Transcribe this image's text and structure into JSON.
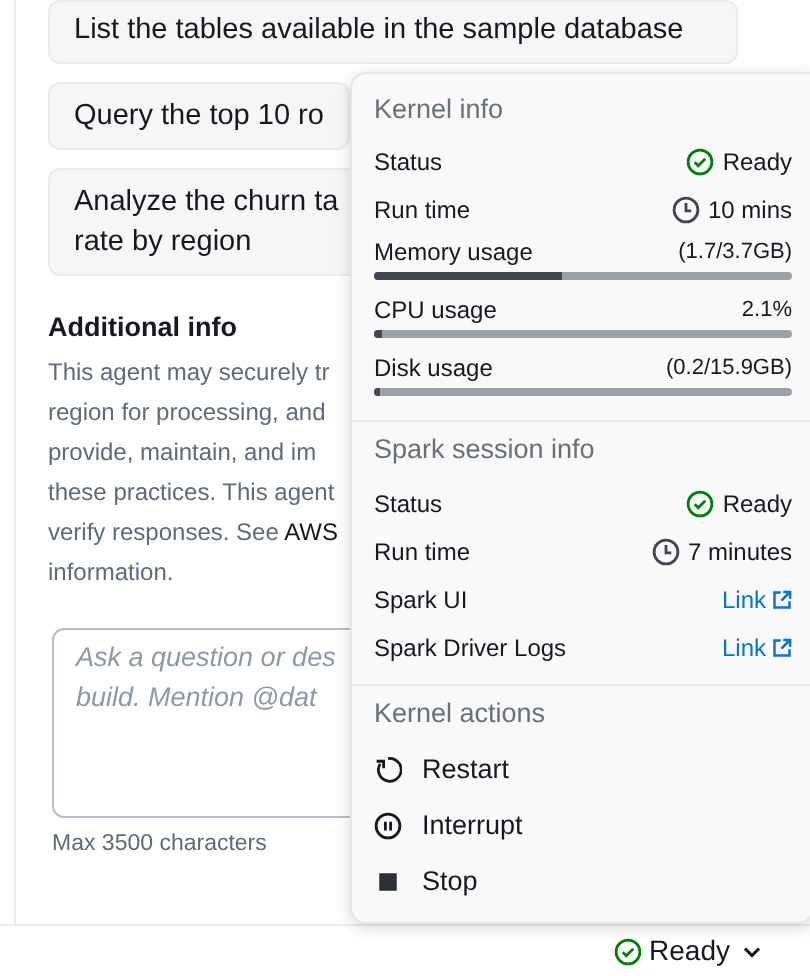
{
  "suggestions": [
    {
      "lines": [
        "List the tables available in the sample database"
      ]
    },
    {
      "lines": [
        "Query the top 10 ro"
      ]
    },
    {
      "lines": [
        "Analyze the churn ta",
        "rate by region"
      ]
    }
  ],
  "additional_info": {
    "title": "Additional info",
    "lines": [
      "This agent may securely tr",
      "region for processing, and",
      "provide, maintain, and im",
      "these practices. This agent",
      "verify responses. See",
      "information."
    ],
    "link": "AWS"
  },
  "prompt": {
    "placeholder": "Ask a question or des\nbuild. Mention @dat",
    "hint": "Max 3500 characters"
  },
  "kernel_menu": {
    "sections": [
      {
        "title": "Kernel info",
        "items": [
          {
            "kind": "status",
            "label": "Status",
            "value": "Ready"
          },
          {
            "kind": "time",
            "label": "Run time",
            "value": "10 mins"
          },
          {
            "kind": "meter",
            "label": "Memory usage",
            "value": "(1.7/3.7GB)",
            "level": 0.45
          },
          {
            "kind": "meter",
            "label": "CPU usage",
            "value": "2.1%",
            "level": 0.021
          },
          {
            "kind": "meter",
            "label": "Disk usage",
            "value": "(0.2/15.9GB)",
            "level": 0.013
          }
        ]
      },
      {
        "title": "Spark session info",
        "items": [
          {
            "kind": "status",
            "label": "Status",
            "value": "Ready"
          },
          {
            "kind": "time",
            "label": "Run time",
            "value": "7 minutes"
          },
          {
            "kind": "link",
            "label": "Spark UI",
            "value": "Link"
          },
          {
            "kind": "link",
            "label": "Spark Driver Logs",
            "value": "Link"
          }
        ]
      },
      {
        "title": "Kernel actions",
        "items": [
          {
            "kind": "restart",
            "label": "Restart"
          },
          {
            "kind": "interrupt",
            "label": "Interrupt"
          },
          {
            "kind": "stop",
            "label": "Stop"
          }
        ]
      }
    ]
  },
  "status_bar": {
    "status": "Ready"
  }
}
